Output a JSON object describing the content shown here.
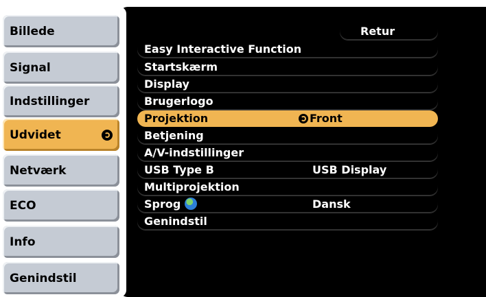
{
  "sidebar": {
    "tabs": [
      {
        "label": "Billede"
      },
      {
        "label": "Signal"
      },
      {
        "label": "Indstillinger"
      },
      {
        "label": "Udvidet"
      },
      {
        "label": "Netværk"
      },
      {
        "label": "ECO"
      },
      {
        "label": "Info"
      },
      {
        "label": "Genindstil"
      }
    ],
    "active_tab": "Udvidet"
  },
  "menu": {
    "retur_label": "Retur",
    "items": [
      {
        "label": "Easy Interactive Function",
        "value": ""
      },
      {
        "label": "Startskærm",
        "value": ""
      },
      {
        "label": "Display",
        "value": ""
      },
      {
        "label": "Brugerlogo",
        "value": ""
      },
      {
        "label": "Projektion",
        "value": "Front"
      },
      {
        "label": "Betjening",
        "value": ""
      },
      {
        "label": "A/V-indstillinger",
        "value": ""
      },
      {
        "label": "USB Type B",
        "value": "USB Display"
      },
      {
        "label": "Multiprojektion",
        "value": ""
      },
      {
        "label": "Sprog",
        "value": "Dansk"
      },
      {
        "label": "Genindstil",
        "value": ""
      }
    ],
    "selected_item": "Projektion"
  },
  "colors": {
    "accent": "#f0b552",
    "tab_inactive": "#c5cbd4",
    "panel_bg": "#000000"
  },
  "icons": {
    "enter": "enter-icon",
    "language": "globe-icon"
  }
}
